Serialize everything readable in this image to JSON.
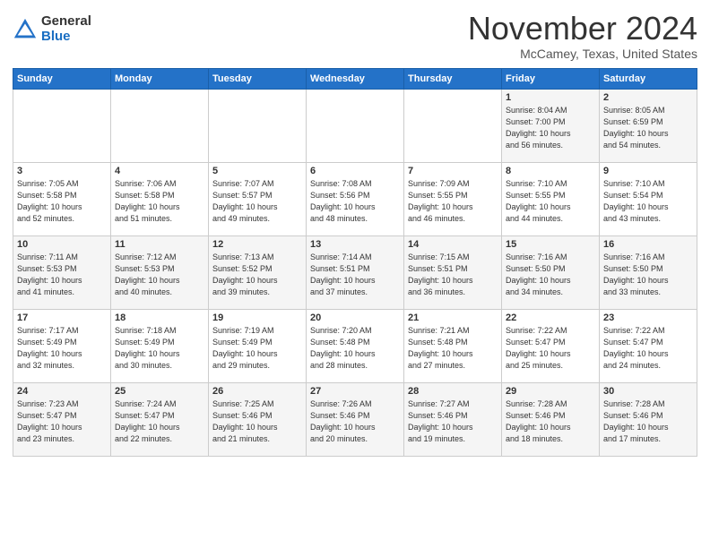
{
  "header": {
    "logo_general": "General",
    "logo_blue": "Blue",
    "month_title": "November 2024",
    "location": "McCamey, Texas, United States"
  },
  "days_of_week": [
    "Sunday",
    "Monday",
    "Tuesday",
    "Wednesday",
    "Thursday",
    "Friday",
    "Saturday"
  ],
  "weeks": [
    [
      {
        "day": "",
        "info": ""
      },
      {
        "day": "",
        "info": ""
      },
      {
        "day": "",
        "info": ""
      },
      {
        "day": "",
        "info": ""
      },
      {
        "day": "",
        "info": ""
      },
      {
        "day": "1",
        "info": "Sunrise: 8:04 AM\nSunset: 7:00 PM\nDaylight: 10 hours\nand 56 minutes."
      },
      {
        "day": "2",
        "info": "Sunrise: 8:05 AM\nSunset: 6:59 PM\nDaylight: 10 hours\nand 54 minutes."
      }
    ],
    [
      {
        "day": "3",
        "info": "Sunrise: 7:05 AM\nSunset: 5:58 PM\nDaylight: 10 hours\nand 52 minutes."
      },
      {
        "day": "4",
        "info": "Sunrise: 7:06 AM\nSunset: 5:58 PM\nDaylight: 10 hours\nand 51 minutes."
      },
      {
        "day": "5",
        "info": "Sunrise: 7:07 AM\nSunset: 5:57 PM\nDaylight: 10 hours\nand 49 minutes."
      },
      {
        "day": "6",
        "info": "Sunrise: 7:08 AM\nSunset: 5:56 PM\nDaylight: 10 hours\nand 48 minutes."
      },
      {
        "day": "7",
        "info": "Sunrise: 7:09 AM\nSunset: 5:55 PM\nDaylight: 10 hours\nand 46 minutes."
      },
      {
        "day": "8",
        "info": "Sunrise: 7:10 AM\nSunset: 5:55 PM\nDaylight: 10 hours\nand 44 minutes."
      },
      {
        "day": "9",
        "info": "Sunrise: 7:10 AM\nSunset: 5:54 PM\nDaylight: 10 hours\nand 43 minutes."
      }
    ],
    [
      {
        "day": "10",
        "info": "Sunrise: 7:11 AM\nSunset: 5:53 PM\nDaylight: 10 hours\nand 41 minutes."
      },
      {
        "day": "11",
        "info": "Sunrise: 7:12 AM\nSunset: 5:53 PM\nDaylight: 10 hours\nand 40 minutes."
      },
      {
        "day": "12",
        "info": "Sunrise: 7:13 AM\nSunset: 5:52 PM\nDaylight: 10 hours\nand 39 minutes."
      },
      {
        "day": "13",
        "info": "Sunrise: 7:14 AM\nSunset: 5:51 PM\nDaylight: 10 hours\nand 37 minutes."
      },
      {
        "day": "14",
        "info": "Sunrise: 7:15 AM\nSunset: 5:51 PM\nDaylight: 10 hours\nand 36 minutes."
      },
      {
        "day": "15",
        "info": "Sunrise: 7:16 AM\nSunset: 5:50 PM\nDaylight: 10 hours\nand 34 minutes."
      },
      {
        "day": "16",
        "info": "Sunrise: 7:16 AM\nSunset: 5:50 PM\nDaylight: 10 hours\nand 33 minutes."
      }
    ],
    [
      {
        "day": "17",
        "info": "Sunrise: 7:17 AM\nSunset: 5:49 PM\nDaylight: 10 hours\nand 32 minutes."
      },
      {
        "day": "18",
        "info": "Sunrise: 7:18 AM\nSunset: 5:49 PM\nDaylight: 10 hours\nand 30 minutes."
      },
      {
        "day": "19",
        "info": "Sunrise: 7:19 AM\nSunset: 5:49 PM\nDaylight: 10 hours\nand 29 minutes."
      },
      {
        "day": "20",
        "info": "Sunrise: 7:20 AM\nSunset: 5:48 PM\nDaylight: 10 hours\nand 28 minutes."
      },
      {
        "day": "21",
        "info": "Sunrise: 7:21 AM\nSunset: 5:48 PM\nDaylight: 10 hours\nand 27 minutes."
      },
      {
        "day": "22",
        "info": "Sunrise: 7:22 AM\nSunset: 5:47 PM\nDaylight: 10 hours\nand 25 minutes."
      },
      {
        "day": "23",
        "info": "Sunrise: 7:22 AM\nSunset: 5:47 PM\nDaylight: 10 hours\nand 24 minutes."
      }
    ],
    [
      {
        "day": "24",
        "info": "Sunrise: 7:23 AM\nSunset: 5:47 PM\nDaylight: 10 hours\nand 23 minutes."
      },
      {
        "day": "25",
        "info": "Sunrise: 7:24 AM\nSunset: 5:47 PM\nDaylight: 10 hours\nand 22 minutes."
      },
      {
        "day": "26",
        "info": "Sunrise: 7:25 AM\nSunset: 5:46 PM\nDaylight: 10 hours\nand 21 minutes."
      },
      {
        "day": "27",
        "info": "Sunrise: 7:26 AM\nSunset: 5:46 PM\nDaylight: 10 hours\nand 20 minutes."
      },
      {
        "day": "28",
        "info": "Sunrise: 7:27 AM\nSunset: 5:46 PM\nDaylight: 10 hours\nand 19 minutes."
      },
      {
        "day": "29",
        "info": "Sunrise: 7:28 AM\nSunset: 5:46 PM\nDaylight: 10 hours\nand 18 minutes."
      },
      {
        "day": "30",
        "info": "Sunrise: 7:28 AM\nSunset: 5:46 PM\nDaylight: 10 hours\nand 17 minutes."
      }
    ]
  ]
}
